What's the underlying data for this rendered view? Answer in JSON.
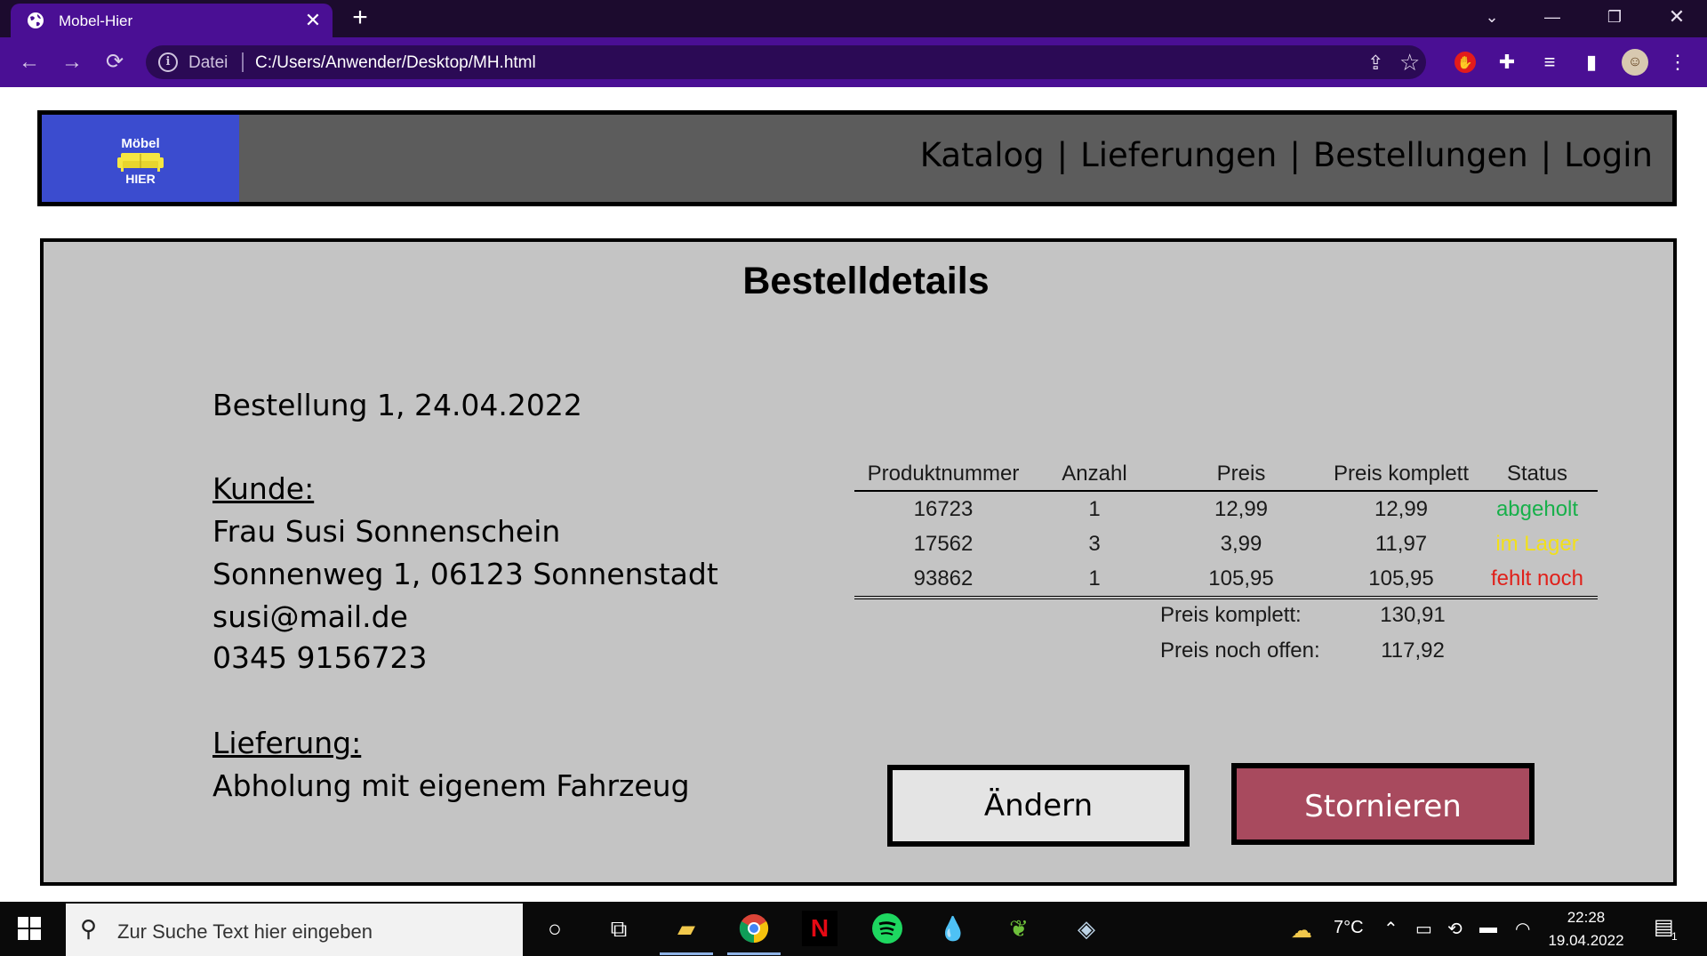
{
  "browser": {
    "tab_title": "Mobel-Hier",
    "tab_close": "✕",
    "new_tab": "+",
    "scheme_label": "Datei",
    "url": "C:/Users/Anwender/Desktop/MH.html"
  },
  "site": {
    "logo_top": "Möbel",
    "logo_bottom": "HIER",
    "nav": [
      "Katalog",
      "Lieferungen",
      "Bestellungen",
      "Login"
    ],
    "nav_separator": "|"
  },
  "order": {
    "title": "Bestelldetails",
    "heading": "Bestellung 1, 24.04.2022",
    "customer_label": "Kunde:",
    "customer_name": "Frau Susi Sonnenschein",
    "customer_address": "Sonnenweg 1, 06123 Sonnenstadt",
    "customer_email": "susi@mail.de",
    "customer_phone": "0345 9156723",
    "delivery_label": "Lieferung:",
    "delivery_method": "Abholung mit eigenem Fahrzeug",
    "table_headers": [
      "Produktnummer",
      "Anzahl",
      "Preis",
      "Preis komplett",
      "Status"
    ],
    "items": [
      {
        "product": "16723",
        "qty": "1",
        "price": "12,99",
        "total": "12,99",
        "status": "abgeholt",
        "status_color": "#17b04a"
      },
      {
        "product": "17562",
        "qty": "3",
        "price": "3,99",
        "total": "11,97",
        "status": "im Lager",
        "status_color": "#f2e01a"
      },
      {
        "product": "93862",
        "qty": "1",
        "price": "105,95",
        "total": "105,95",
        "status": "fehlt noch",
        "status_color": "#e0201a"
      }
    ],
    "sum_total_label": "Preis komplett:",
    "sum_total_value": "130,91",
    "sum_open_label": "Preis noch offen:",
    "sum_open_value": "117,92",
    "btn_change": "Ändern",
    "btn_cancel": "Stornieren"
  },
  "taskbar": {
    "search_placeholder": "Zur Suche Text hier eingeben",
    "weather": "7°C",
    "time": "22:28",
    "date": "19.04.2022",
    "notification_count": "1"
  },
  "colors": {
    "browser_accent": "#4a0f94",
    "logo_bg": "#3b4ccf",
    "header_bg": "#5c5c5c",
    "panel_bg": "#c4c4c4",
    "cancel_button": "#a84a5e"
  }
}
